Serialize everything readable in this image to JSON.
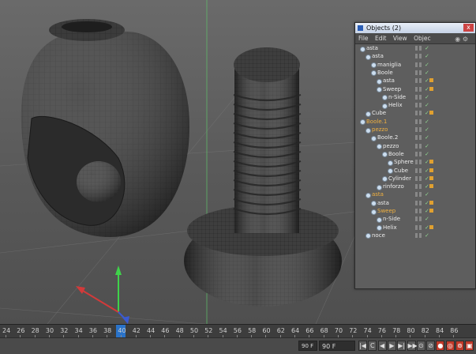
{
  "object_manager": {
    "title": "Objects (2)",
    "close_glyph": "x",
    "menu": [
      "File",
      "Edit",
      "View",
      "Objec"
    ],
    "tools_glyph": "◉ ⚙",
    "items": [
      {
        "label": "asta",
        "depth": 0,
        "icon": "null-object-icon",
        "tag": false,
        "orange": false
      },
      {
        "label": "asta",
        "depth": 1,
        "icon": "symmetry-icon",
        "tag": false,
        "orange": false
      },
      {
        "label": "maniglia",
        "depth": 2,
        "icon": "polygon-icon",
        "tag": false,
        "orange": false
      },
      {
        "label": "Boole",
        "depth": 2,
        "icon": "boole-icon",
        "tag": false,
        "orange": false
      },
      {
        "label": "asta",
        "depth": 3,
        "icon": "polygon-icon",
        "tag": true,
        "orange": false
      },
      {
        "label": "Sweep",
        "depth": 3,
        "icon": "sweep-icon",
        "tag": true,
        "orange": false
      },
      {
        "label": "n-Side",
        "depth": 4,
        "icon": "nside-icon",
        "tag": false,
        "orange": false
      },
      {
        "label": "Helix",
        "depth": 4,
        "icon": "helix-icon",
        "tag": false,
        "orange": false
      },
      {
        "label": "Cube",
        "depth": 1,
        "icon": "cube-icon",
        "tag": true,
        "orange": false
      },
      {
        "label": "Boole.1",
        "depth": 0,
        "icon": "boole-icon",
        "tag": false,
        "orange": true
      },
      {
        "label": "pezzo",
        "depth": 1,
        "icon": "symmetry-icon",
        "tag": false,
        "orange": true
      },
      {
        "label": "Boole.2",
        "depth": 2,
        "icon": "boole-icon",
        "tag": false,
        "orange": false
      },
      {
        "label": "pezzo",
        "depth": 3,
        "icon": "symmetry-icon",
        "tag": false,
        "orange": false
      },
      {
        "label": "Boole",
        "depth": 4,
        "icon": "boole-icon",
        "tag": false,
        "orange": false
      },
      {
        "label": "Sphere",
        "depth": 5,
        "icon": "sphere-icon",
        "tag": true,
        "orange": false
      },
      {
        "label": "Cube",
        "depth": 5,
        "icon": "cube-icon",
        "tag": true,
        "orange": false
      },
      {
        "label": "Cylinder",
        "depth": 4,
        "icon": "cylinder-icon",
        "tag": true,
        "orange": false
      },
      {
        "label": "rinforzo",
        "depth": 3,
        "icon": "polygon-icon",
        "tag": true,
        "orange": false
      },
      {
        "label": "asta",
        "depth": 1,
        "icon": "symmetry-icon",
        "tag": false,
        "orange": true
      },
      {
        "label": "asta",
        "depth": 2,
        "icon": "polygon-icon",
        "tag": true,
        "orange": false
      },
      {
        "label": "Sweep",
        "depth": 2,
        "icon": "sweep-icon",
        "tag": true,
        "orange": true
      },
      {
        "label": "n-Side",
        "depth": 3,
        "icon": "nside-icon",
        "tag": false,
        "orange": false
      },
      {
        "label": "Helix",
        "depth": 3,
        "icon": "helix-icon",
        "tag": true,
        "orange": false
      },
      {
        "label": "noce",
        "depth": 1,
        "icon": "polygon-icon",
        "tag": false,
        "orange": false
      }
    ]
  },
  "timeline": {
    "ticks": [
      "24",
      "26",
      "28",
      "30",
      "32",
      "34",
      "36",
      "38",
      "40",
      "42",
      "44",
      "46",
      "48",
      "50",
      "52",
      "54",
      "56",
      "58",
      "60",
      "62",
      "64",
      "66",
      "68",
      "70",
      "72",
      "74",
      "76",
      "78",
      "80",
      "82",
      "84",
      "86"
    ],
    "current_frame_label": "40"
  },
  "transport": {
    "end_frame_small": "90 F",
    "end_frame": "90 F",
    "buttons": [
      "|◀",
      "C",
      "◀",
      "▶",
      "▶|",
      "▶▶",
      "⊙",
      "⊘",
      "●",
      "◎",
      "⊚",
      "▣"
    ]
  },
  "colors": {
    "accent": "#2a73c9",
    "orange_label": "#f0b040",
    "record_red": "#c23a2a"
  }
}
